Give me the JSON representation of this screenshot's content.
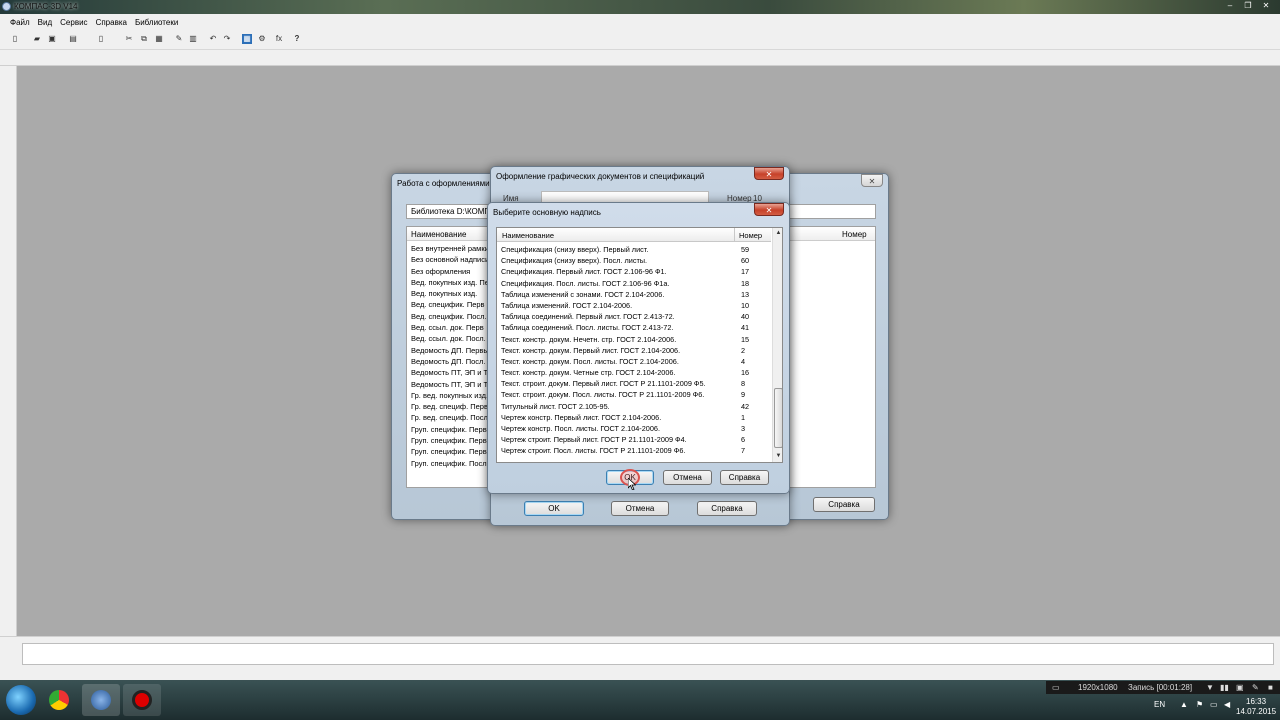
{
  "app": {
    "title": "КОМПАС-3D V14",
    "window_controls": [
      "‒",
      "❐",
      "✕"
    ]
  },
  "menu": [
    "Файл",
    "Вид",
    "Сервис",
    "Справка",
    "Библиотеки"
  ],
  "toolbar": {
    "fx_label": "fx",
    "help_label": "?"
  },
  "dialog_work": {
    "title": "Работа с оформлениями",
    "library_path": "Библиотека D:\\КОМПА",
    "col_name": "Наименование",
    "col_number": "Номер",
    "items": [
      "Без внутренней рамки",
      "Без основной надписи",
      "Без оформления",
      "Вед. покупных изд. Пер",
      "Вед. покупных изд.",
      "Вед. специфик. Перв",
      "Вед. специфик. Посл.",
      "Вед. ссыл. док. Перв",
      "Вед. ссыл. док. Посл.",
      "Ведомость ДП. Первый",
      "Ведомость ДП. Посл.",
      "Ведомость ПТ, ЭП и ТП",
      "Ведомость ПТ, ЭП и ТП",
      "Гр. вед. покупных изд.",
      "Гр. вед. специф. Перв",
      "Гр. вед. специф. Посл.",
      "Груп. специфик. Перв",
      "Груп. специфик. Перв",
      "Груп. специфик. Перв",
      "Груп. специфик. Посл."
    ],
    "help_button": "Справка"
  },
  "dialog_format": {
    "title": "Оформление графических документов и спецификаций",
    "name_label": "Имя",
    "number_label": "Номер",
    "number_value": "10",
    "ok_button": "OK",
    "cancel_button": "Отмена",
    "help_button": "Справка"
  },
  "dialog_select": {
    "title": "Выберите основную надпись",
    "col_name": "Наименование",
    "col_number": "Номер",
    "rows": [
      {
        "name": "Спецификация (снизу вверх). Первый лист.",
        "number": "59"
      },
      {
        "name": "Спецификация (снизу вверх). Посл. листы.",
        "number": "60"
      },
      {
        "name": "Спецификация. Первый лист. ГОСТ 2.106-96 Ф1.",
        "number": "17"
      },
      {
        "name": "Спецификация. Посл. листы. ГОСТ 2.106-96 Ф1а.",
        "number": "18"
      },
      {
        "name": "Таблица изменений с зонами. ГОСТ 2.104-2006.",
        "number": "13"
      },
      {
        "name": "Таблица изменений. ГОСТ 2.104-2006.",
        "number": "10"
      },
      {
        "name": "Таблица соединений. Первый лист. ГОСТ 2.413-72.",
        "number": "40"
      },
      {
        "name": "Таблица соединений. Посл. листы. ГОСТ 2.413-72.",
        "number": "41"
      },
      {
        "name": "Текст. констр. докум. Нечетн. стр. ГОСТ 2.104-2006.",
        "number": "15"
      },
      {
        "name": "Текст. констр. докум. Первый лист. ГОСТ 2.104-2006.",
        "number": "2"
      },
      {
        "name": "Текст. констр. докум. Посл. листы. ГОСТ 2.104-2006.",
        "number": "4"
      },
      {
        "name": "Текст. констр. докум. Четные стр. ГОСТ 2.104-2006.",
        "number": "16"
      },
      {
        "name": "Текст. строит. докум. Первый лист. ГОСТ Р 21.1101-2009 Ф5.",
        "number": "8"
      },
      {
        "name": "Текст. строит. докум. Посл. листы. ГОСТ Р 21.1101-2009 Ф6.",
        "number": "9"
      },
      {
        "name": "Титульный лист. ГОСТ 2.105-95.",
        "number": "42"
      },
      {
        "name": "Чертеж констр. Первый лист. ГОСТ 2.104-2006.",
        "number": "1"
      },
      {
        "name": "Чертеж констр. Посл. листы. ГОСТ 2.104-2006.",
        "number": "3"
      },
      {
        "name": "Чертеж строит. Первый лист. ГОСТ Р 21.1101-2009 Ф4.",
        "number": "6"
      },
      {
        "name": "Чертеж строит. Посл. листы. ГОСТ Р 21.1101-2009 Ф6.",
        "number": "7"
      }
    ],
    "ok_button": "OK",
    "cancel_button": "Отмена",
    "help_button": "Справка"
  },
  "tray": {
    "resolution": "1920x1080",
    "recording": "Запись [00:01:28]",
    "language": "EN",
    "time": "16:33",
    "date": "14.07.2015"
  }
}
